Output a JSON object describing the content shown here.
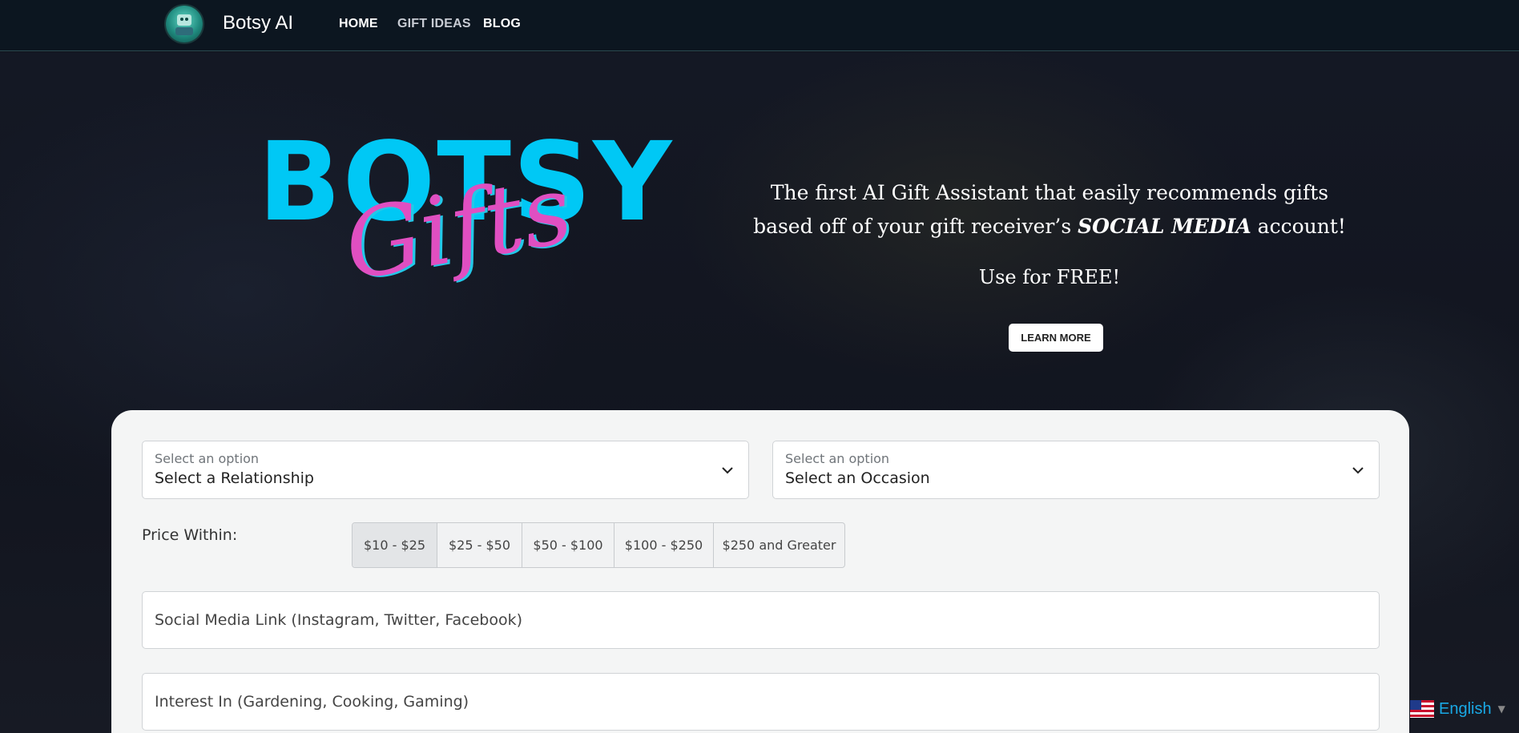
{
  "nav": {
    "brand": "Botsy AI",
    "links": [
      {
        "label": "HOME"
      },
      {
        "label": "GIFT IDEAS"
      },
      {
        "label": "BLOG"
      }
    ]
  },
  "hero": {
    "logo_word_1": "BOTSY",
    "logo_word_2": "Gifts",
    "tagline_part_1": "The first AI Gift Assistant that easily recommends gifts based off of your gift receiver’s ",
    "tagline_emphasis": "SOCIAL MEDIA",
    "tagline_part_2": " account!",
    "free_text": "Use for FREE!",
    "cta_label": "LEARN MORE"
  },
  "form": {
    "relationship_select": {
      "hint": "Select an option",
      "value": "Select a Relationship"
    },
    "occasion_select": {
      "hint": "Select an option",
      "value": "Select an Occasion"
    },
    "price_label": "Price Within:",
    "price_options": [
      {
        "label": "$10 - $25",
        "active": true
      },
      {
        "label": "$25 - $50",
        "active": false
      },
      {
        "label": "$50 - $100",
        "active": false
      },
      {
        "label": "$100 - $250",
        "active": false
      },
      {
        "label": "$250 and Greater",
        "active": false
      }
    ],
    "social_placeholder": "Social Media Link (Instagram, Twitter, Facebook)",
    "interest_placeholder": "Interest In (Gardening, Cooking, Gaming)"
  },
  "language": {
    "label": "English",
    "flag_icon": "us-flag-icon"
  },
  "colors": {
    "logo_cyan": "#00c8f5",
    "logo_pink": "#e04fc1",
    "lang_link": "#19a9e6"
  }
}
